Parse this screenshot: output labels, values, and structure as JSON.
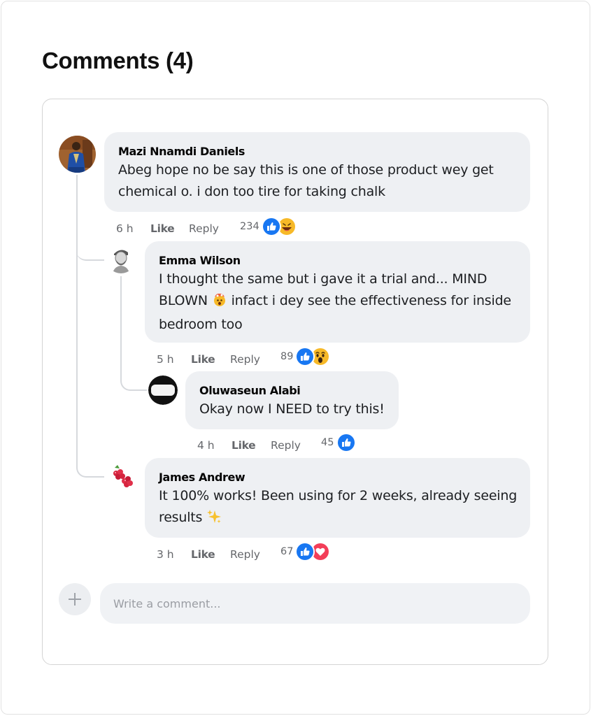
{
  "title": "Comments (4)",
  "comments": [
    {
      "author": "Mazi Nnamdi Daniels",
      "lines": [
        "Abeg hope no be say this is one of those product wey get",
        "chemical o. i don too tire for taking chalk"
      ],
      "time": "6 h",
      "like": "Like",
      "reply": "Reply",
      "count": "234",
      "reactions": [
        "like-icon",
        "laugh-icon"
      ],
      "avatar": "man-in-blue-attire-avatar"
    },
    {
      "author": "Emma Wilson",
      "lines": [
        "I thought the same but i gave it a trial and... MIND",
        "BLOWN",
        "infact i dey see the effectiveness for inside",
        "bedroom too"
      ],
      "emoji": "exploding-head-emoji",
      "time": "5 h",
      "like": "Like",
      "reply": "Reply",
      "count": "89",
      "reactions": [
        "like-icon",
        "wow-icon"
      ],
      "avatar": "bearded-man-sketch-avatar"
    },
    {
      "author": "Oluwaseun Alabi",
      "lines": [
        "Okay now I NEED to try this!"
      ],
      "time": "4 h",
      "like": "Like",
      "reply": "Reply",
      "count": "45",
      "reactions": [
        "like-icon"
      ],
      "avatar": "black-white-circle-avatar"
    },
    {
      "author": "James Andrew",
      "lines": [
        "It 100% works! Been using for 2 weeks, already seeing",
        "results"
      ],
      "emoji": "sparkles-emoji",
      "time": "3 h",
      "like": "Like",
      "reply": "Reply",
      "count": "67",
      "reactions": [
        "like-icon",
        "love-icon"
      ],
      "avatar": "raspberry-avatar"
    }
  ],
  "composer": {
    "placeholder": "Write a comment...",
    "add_icon": "plus-icon"
  },
  "colors": {
    "like_blue": "#1877f2",
    "love_red": "#f33e58",
    "bubble": "#eef0f3",
    "meta_gray": "#65676b"
  }
}
